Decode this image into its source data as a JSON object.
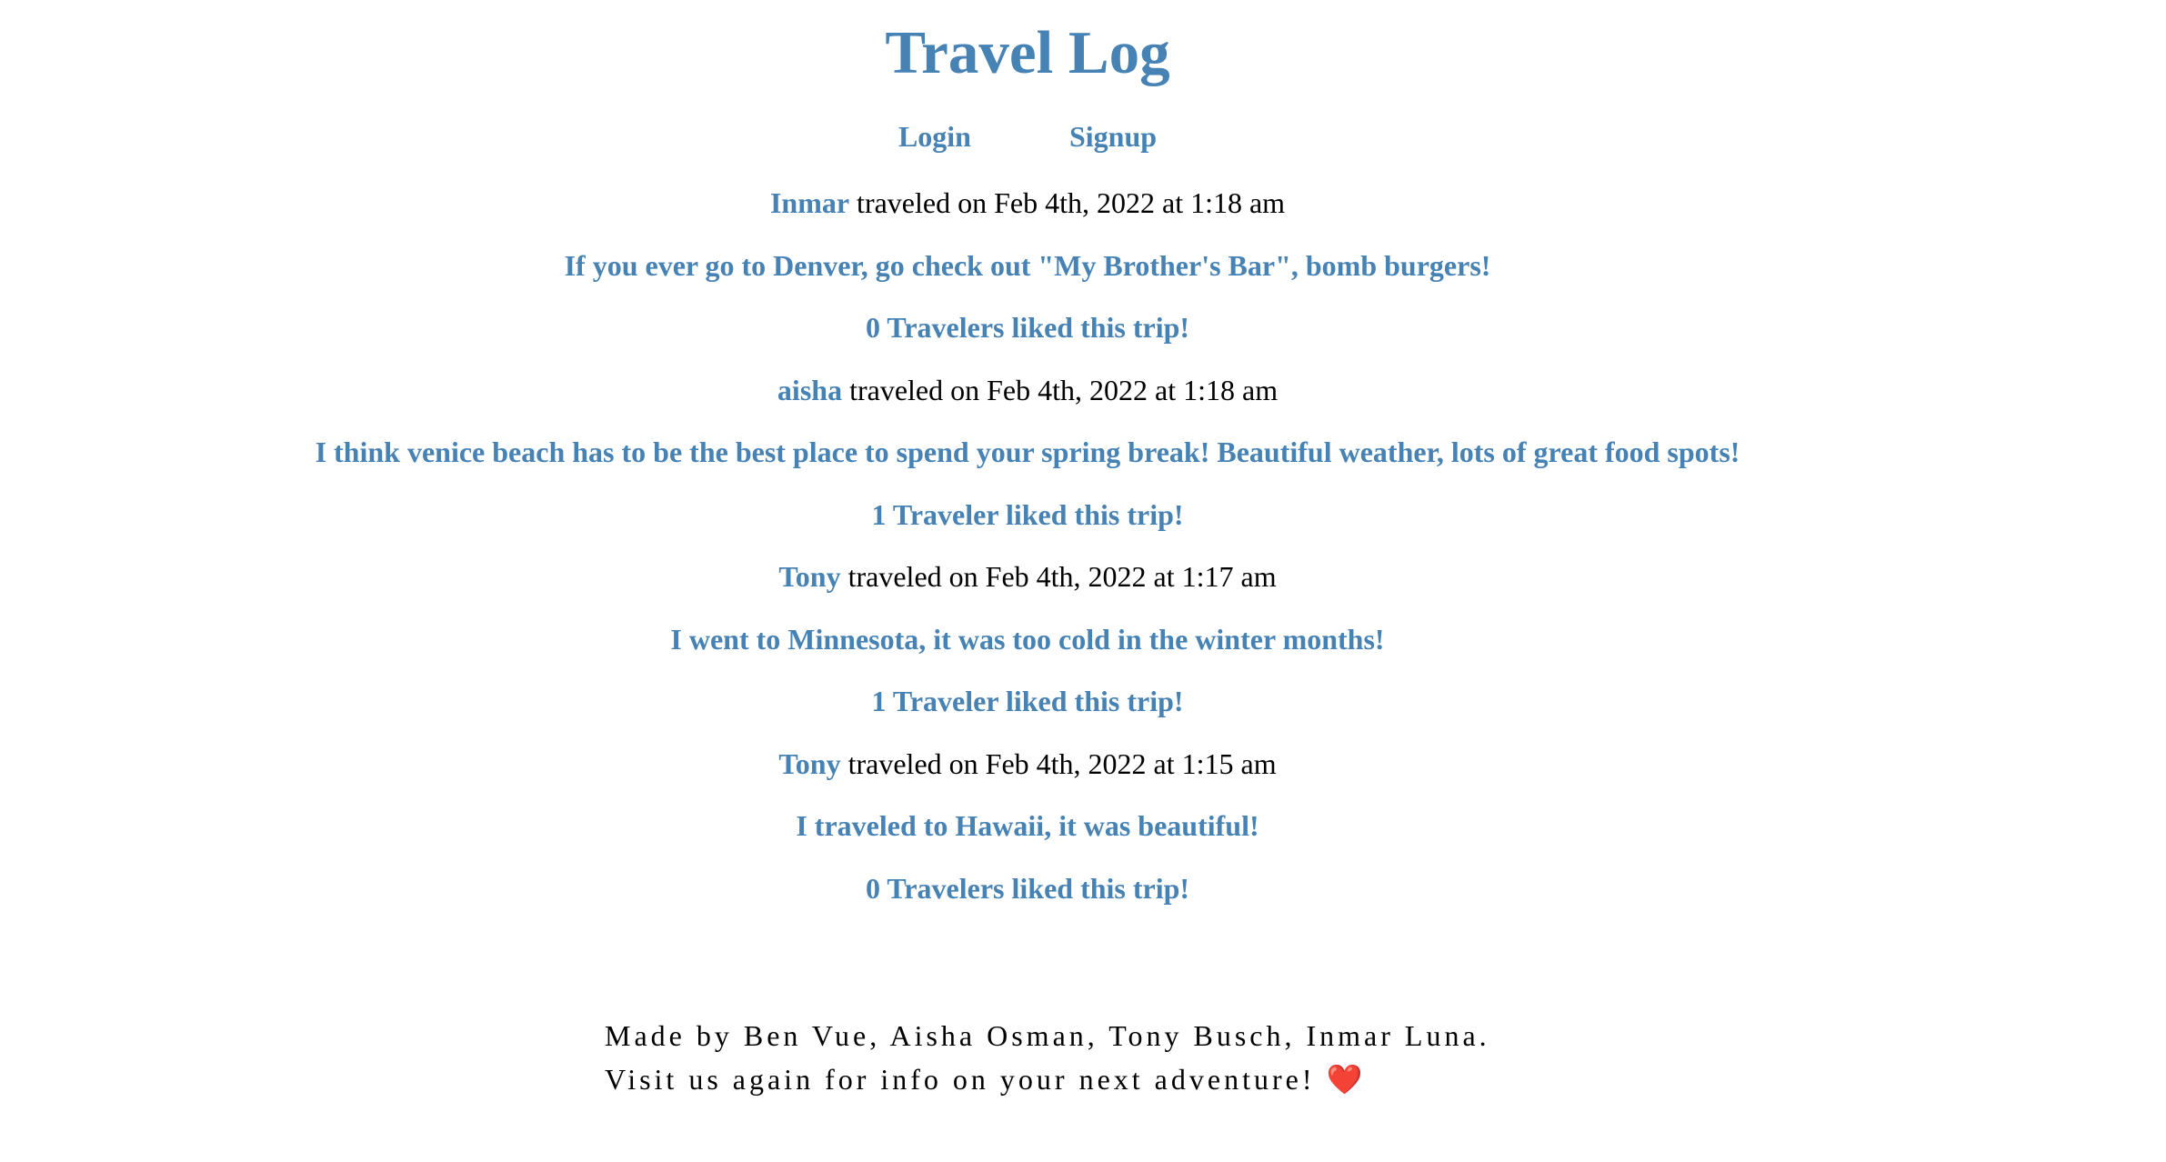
{
  "header": {
    "title": "Travel Log"
  },
  "nav": {
    "login": "Login",
    "signup": "Signup"
  },
  "posts": [
    {
      "user": "Inmar",
      "meta": " traveled on Feb 4th, 2022 at 1:18 am",
      "text": "If you ever go to Denver, go check out \"My Brother's Bar\", bomb burgers!",
      "likes": "0 Travelers liked this trip!"
    },
    {
      "user": "aisha",
      "meta": " traveled on Feb 4th, 2022 at 1:18 am",
      "text": "I think venice beach has to be the best place to spend your spring break! Beautiful weather, lots of great food spots!",
      "likes": "1 Traveler liked this trip!"
    },
    {
      "user": "Tony",
      "meta": " traveled on Feb 4th, 2022 at 1:17 am",
      "text": "I went to Minnesota, it was too cold in the winter months!",
      "likes": "1 Traveler liked this trip!"
    },
    {
      "user": "Tony",
      "meta": " traveled on Feb 4th, 2022 at 1:15 am",
      "text": "I traveled to Hawaii, it was beautiful!",
      "likes": "0 Travelers liked this trip!"
    }
  ],
  "footer": {
    "line1": "Made by Ben Vue, Aisha Osman, Tony Busch, Inmar Luna.",
    "line2": "Visit us again for info on your next adventure! ",
    "heart": "❤️"
  },
  "colors": {
    "accent": "#4682b4",
    "text": "#000000",
    "background": "#ffffff"
  }
}
